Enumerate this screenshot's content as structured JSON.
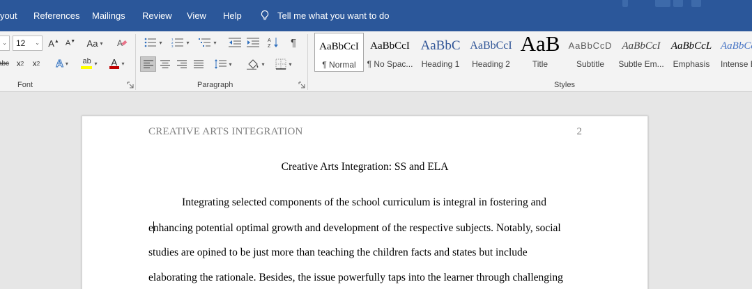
{
  "menu": {
    "tabs": [
      "yout",
      "References",
      "Mailings",
      "Review",
      "View",
      "Help"
    ],
    "tell_me": "Tell me what you want to do"
  },
  "ribbon": {
    "font": {
      "size": "12",
      "change_case": "Aa",
      "grow": "A",
      "shrink": "A",
      "strike": "abc",
      "subscript": "x",
      "subscript_mark": "2",
      "superscript": "x",
      "superscript_mark": "2",
      "label": "Font"
    },
    "paragraph": {
      "label": "Paragraph",
      "pilcrow": "¶"
    },
    "styles": {
      "label": "Styles",
      "items": [
        {
          "sample": "AaBbCcI",
          "name": "¶ Normal"
        },
        {
          "sample": "AaBbCcI",
          "name": "¶ No Spac..."
        },
        {
          "sample": "AaBbC",
          "name": "Heading 1"
        },
        {
          "sample": "AaBbCcI",
          "name": "Heading 2"
        },
        {
          "sample": "AaB",
          "name": "Title"
        },
        {
          "sample": "AaBbCcD",
          "name": "Subtitle"
        },
        {
          "sample": "AaBbCcI",
          "name": "Subtle Em..."
        },
        {
          "sample": "AaBbCcL",
          "name": "Emphasis"
        },
        {
          "sample": "AaBbCcI",
          "name": "Intense E"
        }
      ]
    }
  },
  "colors": {
    "title_bar": "#2b579a",
    "highlight": "#ffff00",
    "font_color": "#c00000",
    "heading_blue": "#2f5496"
  },
  "document": {
    "header_left": "CREATIVE ARTS INTEGRATION",
    "page_number": "2",
    "title": "Creative Arts Integration: SS and ELA",
    "lines": [
      "Integrating selected components of the school curriculum is integral in fostering and",
      "nhancing potential optimal growth and development of the respective subjects. Notably, social",
      "studies are opined to be just more than teaching the children facts and states but include",
      "elaborating the rationale. Besides, the issue powerfully taps into the learner through challenging"
    ],
    "line2_prefix": "e"
  }
}
